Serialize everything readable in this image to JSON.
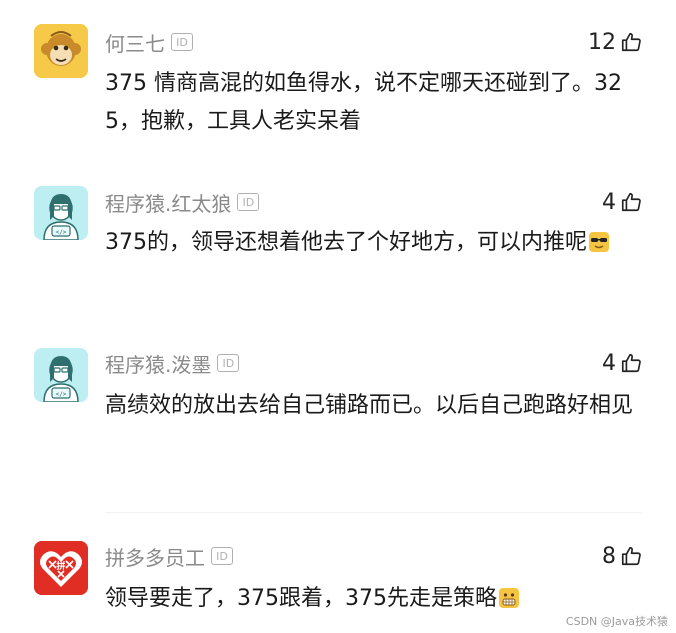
{
  "comments": [
    {
      "username": "何三七",
      "badge": "ID",
      "likes": "12",
      "avatar": "monkey-avatar",
      "text": "375 情商高混的如鱼得水，说不定哪天还碰到了。325，抱歉，工具人老实呆着"
    },
    {
      "username": "程序猿.红太狼",
      "badge": "ID",
      "likes": "4",
      "avatar": "programmer-avatar",
      "text": "375的，领导还想着他去了个好地方，可以内推呢",
      "emoji": "sunglasses-emoji"
    },
    {
      "username": "程序猿.泼墨",
      "badge": "ID",
      "likes": "4",
      "avatar": "programmer-avatar",
      "text": "高绩效的放出去给自己铺路而已。以后自己跑路好相见"
    },
    {
      "username": "拼多多员工",
      "badge": "ID",
      "likes": "8",
      "avatar": "pinduoduo-avatar",
      "text": "领导要走了，375跟着，375先走是策略",
      "emoji": "grimace-emoji"
    }
  ],
  "watermark": "CSDN @Java技术猿",
  "colors": {
    "username": "#8a8a8a",
    "text": "#1a1a1a",
    "pdd_red": "#e02e24",
    "monkey_bg": "#f7c948",
    "programmer_bg": "#bdeff2"
  }
}
